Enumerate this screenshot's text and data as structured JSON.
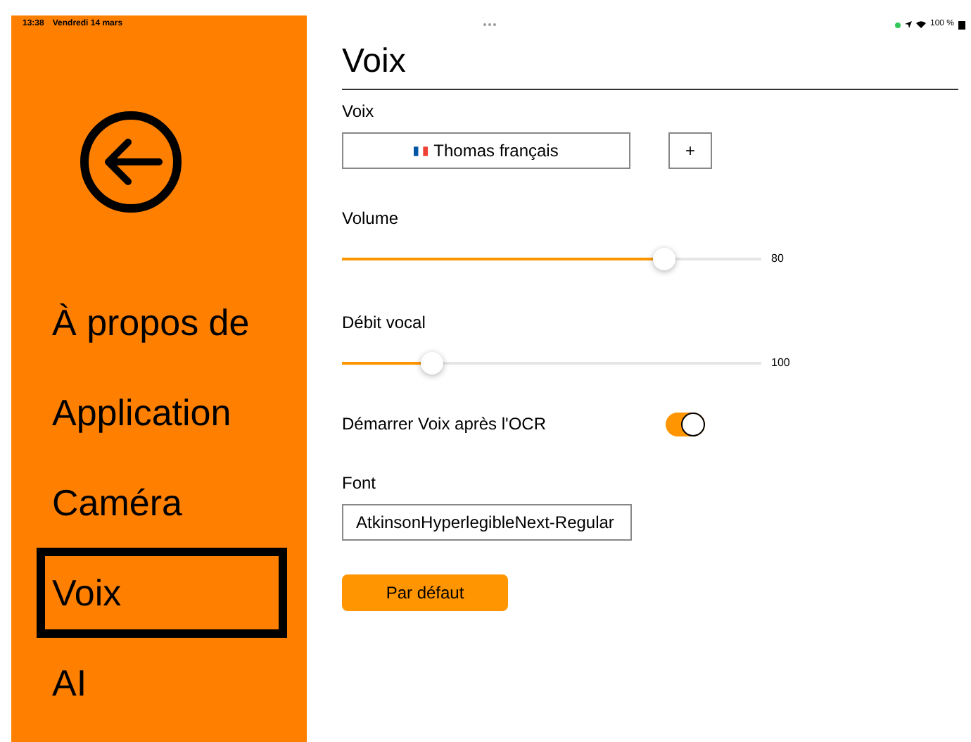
{
  "status_bar": {
    "time": "13:38",
    "date": "Vendredi 14 mars",
    "battery": "100 %"
  },
  "sidebar": {
    "items": [
      {
        "label": "À propos de",
        "selected": false
      },
      {
        "label": "Application",
        "selected": false
      },
      {
        "label": "Caméra",
        "selected": false
      },
      {
        "label": "Voix",
        "selected": true
      },
      {
        "label": "AI",
        "selected": false
      }
    ]
  },
  "title": "Voix",
  "voice": {
    "label": "Voix",
    "value": "Thomas français",
    "add": "+"
  },
  "sliders": [
    {
      "label": "Volume",
      "level": 0.77,
      "reading": "80"
    },
    {
      "label": "Débit vocal",
      "level": 0.215,
      "reading": "100"
    }
  ],
  "toggle": {
    "label": "Démarrer Voix après l'OCR",
    "on": true
  },
  "font": {
    "label": "Font",
    "value": "AtkinsonHyperlegibleNext-Regular"
  },
  "default_button": "Par défaut"
}
